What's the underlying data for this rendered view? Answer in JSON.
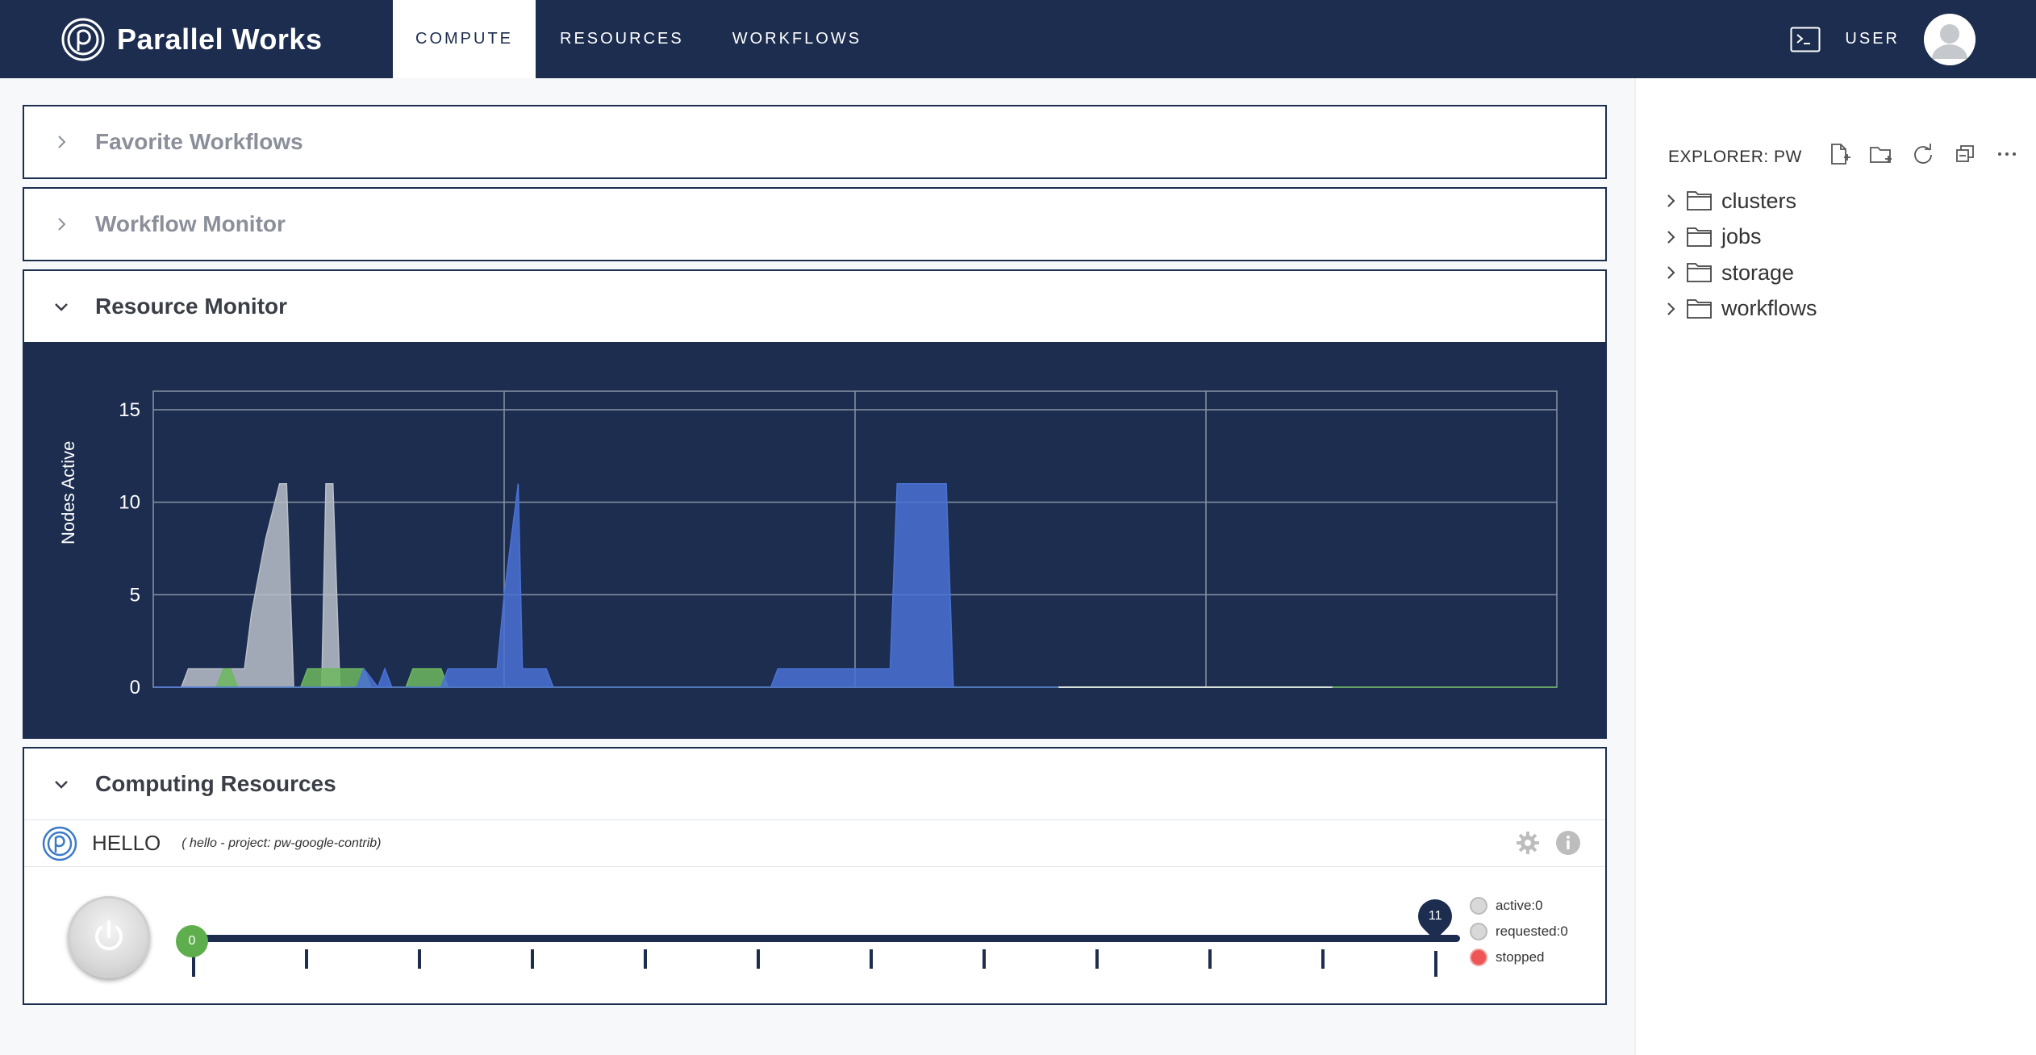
{
  "topbar": {
    "brand": "Parallel Works",
    "tabs": [
      {
        "label": "COMPUTE",
        "active": true
      },
      {
        "label": "RESOURCES",
        "active": false
      },
      {
        "label": "WORKFLOWS",
        "active": false
      }
    ],
    "user_label": "USER",
    "terminal_icon": "terminal-icon"
  },
  "panels": {
    "favorite_workflows": {
      "title": "Favorite Workflows",
      "expanded": false
    },
    "workflow_monitor": {
      "title": "Workflow Monitor",
      "expanded": false
    },
    "resource_monitor": {
      "title": "Resource Monitor",
      "expanded": true
    },
    "computing_resources": {
      "title": "Computing Resources",
      "expanded": true
    }
  },
  "chart_data": {
    "type": "area",
    "ylabel": "Nodes Active",
    "xlabel": "",
    "ylim": [
      0,
      16
    ],
    "yticks": [
      0,
      5,
      10,
      15
    ],
    "grid": true,
    "x_gridlines": 4,
    "xlim": [
      0,
      100
    ],
    "series": [
      {
        "color": "#b8bfc9",
        "points": [
          [
            0,
            0
          ],
          [
            2,
            0
          ],
          [
            2.5,
            1
          ],
          [
            6.5,
            1
          ],
          [
            7,
            4
          ],
          [
            8,
            8
          ],
          [
            9,
            11
          ],
          [
            9.5,
            11
          ],
          [
            10,
            0
          ],
          [
            12,
            0
          ],
          [
            12.3,
            11
          ],
          [
            12.8,
            11
          ],
          [
            13.3,
            0
          ],
          [
            14,
            0
          ]
        ]
      },
      {
        "color": "#6db85f",
        "points": [
          [
            4.5,
            0
          ],
          [
            5,
            1
          ],
          [
            5.5,
            1
          ],
          [
            6,
            0
          ],
          [
            10.5,
            0
          ],
          [
            11,
            1
          ],
          [
            12,
            1
          ],
          [
            13,
            1
          ],
          [
            15,
            1
          ],
          [
            15.5,
            0
          ],
          [
            18,
            0
          ],
          [
            18.5,
            1
          ],
          [
            20.5,
            1
          ],
          [
            21,
            0
          ],
          [
            100,
            0
          ]
        ]
      },
      {
        "color": "#4a72d4",
        "points": [
          [
            0,
            0
          ],
          [
            14.5,
            0
          ],
          [
            15,
            1
          ],
          [
            16,
            0
          ],
          [
            16.5,
            1
          ],
          [
            17,
            0
          ],
          [
            20.5,
            0
          ],
          [
            21,
            1
          ],
          [
            24.5,
            1
          ],
          [
            25,
            5
          ],
          [
            26,
            11
          ],
          [
            26.3,
            1
          ],
          [
            28,
            1
          ],
          [
            28.5,
            0
          ],
          [
            44,
            0
          ],
          [
            44.5,
            1
          ],
          [
            52.5,
            1
          ],
          [
            53,
            11
          ],
          [
            56.5,
            11
          ],
          [
            57,
            0
          ],
          [
            64.5,
            0
          ]
        ]
      },
      {
        "color": "#ffffff",
        "points": [
          [
            64.5,
            0
          ],
          [
            84,
            0
          ]
        ]
      }
    ]
  },
  "resource": {
    "name": "HELLO",
    "subtitle": "( hello - project: pw-google-contrib)",
    "slider_min": "0",
    "slider_max": "11",
    "ticks": 12,
    "legend": [
      {
        "label": "active:0",
        "color": "#d8d8d8"
      },
      {
        "label": "requested:0",
        "color": "#d8d8d8"
      },
      {
        "label": "stopped",
        "color": "#ee5555"
      }
    ]
  },
  "explorer": {
    "title": "EXPLORER: PW",
    "tools": [
      "new-file-icon",
      "new-folder-icon",
      "refresh-icon",
      "collapse-icon",
      "more-icon"
    ],
    "items": [
      {
        "label": "clusters"
      },
      {
        "label": "jobs"
      },
      {
        "label": "storage"
      },
      {
        "label": "workflows"
      }
    ]
  }
}
